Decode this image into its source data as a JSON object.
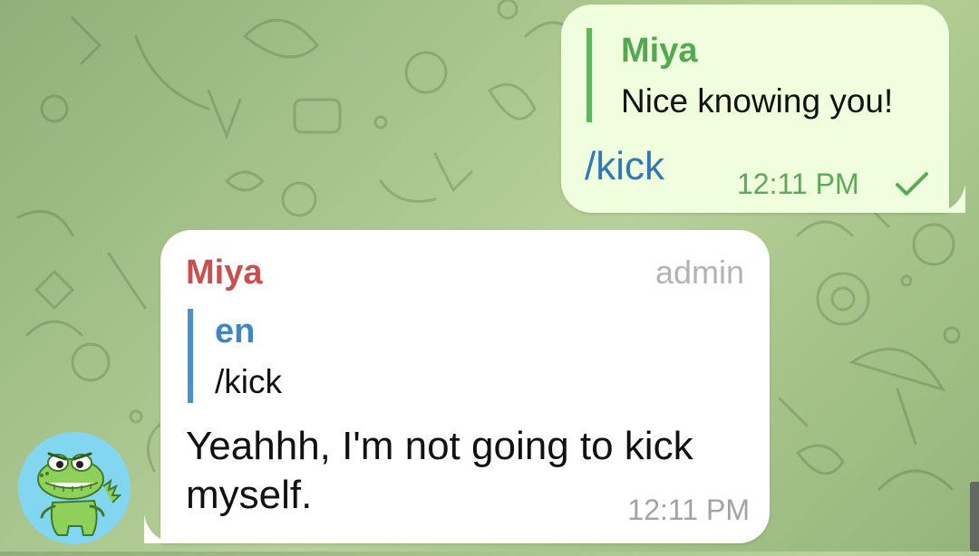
{
  "outgoing_message": {
    "reply_to": {
      "name": "Miya",
      "text": "Nice knowing you!"
    },
    "text": "/kick",
    "time": "12:11 PM",
    "status": "sent",
    "status_icon": "single-check-icon",
    "colors": {
      "bubble": "#effedd",
      "reply_name": "#54a852",
      "command_link": "#2f79b9",
      "time": "#5ea85a"
    }
  },
  "incoming_message": {
    "sender": "Miya",
    "sender_role": "admin",
    "reply_to": {
      "name": "en",
      "text": "/kick"
    },
    "text": "Yeahhh, I'm not going to kick myself.",
    "time": "12:11 PM",
    "colors": {
      "bubble": "#ffffff",
      "sender_name": "#c8504f",
      "reply_name": "#3f87c4",
      "role": "#b3b3b3"
    }
  },
  "avatar": {
    "icon": "green-dinosaur-avatar-icon",
    "background": "#83d6ef"
  },
  "wallpaper": {
    "style": "doodle-pattern",
    "base_color": "#a8c58d"
  }
}
